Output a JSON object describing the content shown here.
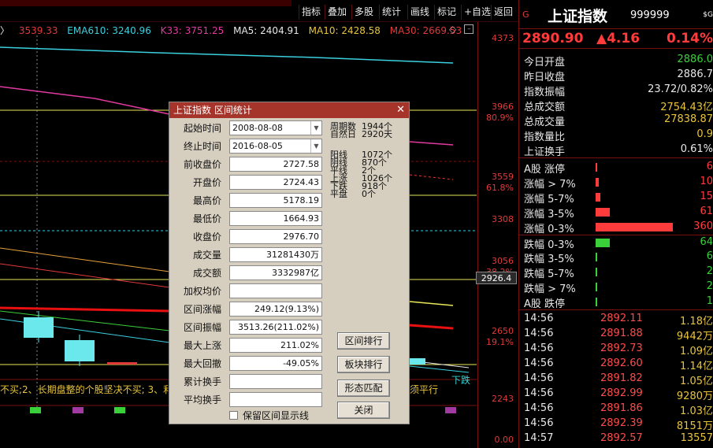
{
  "toolbar": {
    "items": [
      "指标",
      "叠加",
      "多股",
      "统计",
      "画线",
      "标记",
      "+自选",
      "返回"
    ]
  },
  "ma_line": {
    "prefix": "〉",
    "v1": "3539.33",
    "ema610": "EMA610: 3240.96",
    "k33": "K33: 3751.25",
    "ma5": "MA5: 2404.91",
    "ma10": "MA10: 2428.58",
    "ma30": "MA30: 2669.53"
  },
  "axis_labels": [
    "4373",
    "3966",
    "80.9%",
    "3559",
    "61.8%",
    "3308",
    "3056",
    "38.2%",
    "2650",
    "19.1%",
    "2243",
    "0.00"
  ],
  "price_tag": "2926.4",
  "bottom_note": "不买;2、长期盘整的个股坚决不买; 3、利",
  "bottom_note_right": "须平行",
  "xiadie": "下跌",
  "right_panel": {
    "g": "G",
    "name": "上证指数",
    "code": "999999",
    "sg": "$G",
    "price": "2890.90",
    "change": "▲4.16",
    "change_pct": "0.14%",
    "stats": [
      {
        "k": "今日开盘",
        "v": "2886.0",
        "c": "#3ad03a"
      },
      {
        "k": "昨日收盘",
        "v": "2886.7",
        "c": "#e8e8e8"
      },
      {
        "k": "指数振幅",
        "v": "23.72/0.82%",
        "c": "#e8e8e8"
      },
      {
        "k": "总成交额",
        "v": "2754.43亿",
        "c": "#e8c43a"
      },
      {
        "k": "总成交量",
        "v": "27838.87",
        "c": "#e8c43a"
      },
      {
        "k": "指数量比",
        "v": "0.9",
        "c": "#e8c43a"
      },
      {
        "k": "上证换手",
        "v": "0.61%",
        "c": "#e8e8e8"
      }
    ],
    "breadth": [
      {
        "k": "A股 涨停",
        "v": "6",
        "c": "#ff3b3b",
        "w": 2
      },
      {
        "k": "涨幅 > 7%",
        "v": "10",
        "c": "#ff3b3b",
        "w": 4
      },
      {
        "k": "涨幅 5-7%",
        "v": "15",
        "c": "#ff3b3b",
        "w": 6
      },
      {
        "k": "涨幅 3-5%",
        "v": "61",
        "c": "#ff3b3b",
        "w": 18
      },
      {
        "k": "涨幅 0-3%",
        "v": "360",
        "c": "#ff3b3b",
        "w": 98
      },
      {
        "k": "跌幅 0-3%",
        "v": "64",
        "c": "#3ad03a",
        "w": 18
      },
      {
        "k": "跌幅 3-5%",
        "v": "6",
        "c": "#3ad03a",
        "w": 2
      },
      {
        "k": "跌幅 5-7%",
        "v": "2",
        "c": "#3ad03a",
        "w": 2
      },
      {
        "k": "跌幅 > 7%",
        "v": "2",
        "c": "#3ad03a",
        "w": 2
      },
      {
        "k": "A股 跌停",
        "v": "1",
        "c": "#3ad03a",
        "w": 2
      }
    ],
    "trades": [
      {
        "t": "14:56",
        "p": "2892.11",
        "q": "1.18亿"
      },
      {
        "t": "14:56",
        "p": "2891.88",
        "q": "9442万"
      },
      {
        "t": "14:56",
        "p": "2892.73",
        "q": "1.09亿"
      },
      {
        "t": "14:56",
        "p": "2892.60",
        "q": "1.14亿"
      },
      {
        "t": "14:56",
        "p": "2891.82",
        "q": "1.05亿"
      },
      {
        "t": "14:56",
        "p": "2892.99",
        "q": "9280万"
      },
      {
        "t": "14:56",
        "p": "2891.86",
        "q": "1.03亿"
      },
      {
        "t": "14:56",
        "p": "2892.39",
        "q": "8151万"
      },
      {
        "t": "14:57",
        "p": "2892.57",
        "q": "13557"
      }
    ]
  },
  "dialog": {
    "title": "上证指数 区间统计",
    "close": "✕",
    "start_label": "起始时间",
    "start_value": "2008-08-08",
    "end_label": "终止时间",
    "end_value": "2016-08-05",
    "fields": [
      {
        "label": "前收盘价",
        "value": "2727.58"
      },
      {
        "label": "开盘价",
        "value": "2724.43"
      },
      {
        "label": "最高价",
        "value": "5178.19"
      },
      {
        "label": "最低价",
        "value": "1664.93"
      },
      {
        "label": "收盘价",
        "value": "2976.70"
      },
      {
        "label": "成交量",
        "value": "31281430万"
      },
      {
        "label": "成交额",
        "value": "3332987亿"
      },
      {
        "label": "加权均价",
        "value": ""
      },
      {
        "label": "区间涨幅",
        "value": "249.12(9.13%)"
      },
      {
        "label": "区间振幅",
        "value": "3513.26(211.02%)"
      },
      {
        "label": "最大上涨",
        "value": "211.02%"
      },
      {
        "label": "最大回撤",
        "value": "-49.05%"
      },
      {
        "label": "累计换手",
        "value": ""
      },
      {
        "label": "平均换手",
        "value": ""
      }
    ],
    "period_stats": [
      {
        "k": "周期数",
        "v": "1944个"
      },
      {
        "k": "自然日",
        "v": "2920天"
      }
    ],
    "line_stats": [
      {
        "k": "阳线",
        "v": "1072个"
      },
      {
        "k": "阴线",
        "v": "870个"
      },
      {
        "k": "平线",
        "v": "2个"
      },
      {
        "k": "上涨",
        "v": "1026个"
      },
      {
        "k": "下跌",
        "v": "918个"
      },
      {
        "k": "平盘",
        "v": "0个"
      }
    ],
    "buttons": {
      "rank": "区间排行",
      "sector": "板块排行",
      "pattern": "形态匹配",
      "close": "关闭"
    },
    "checkbox_label": "保留区间显示线"
  }
}
